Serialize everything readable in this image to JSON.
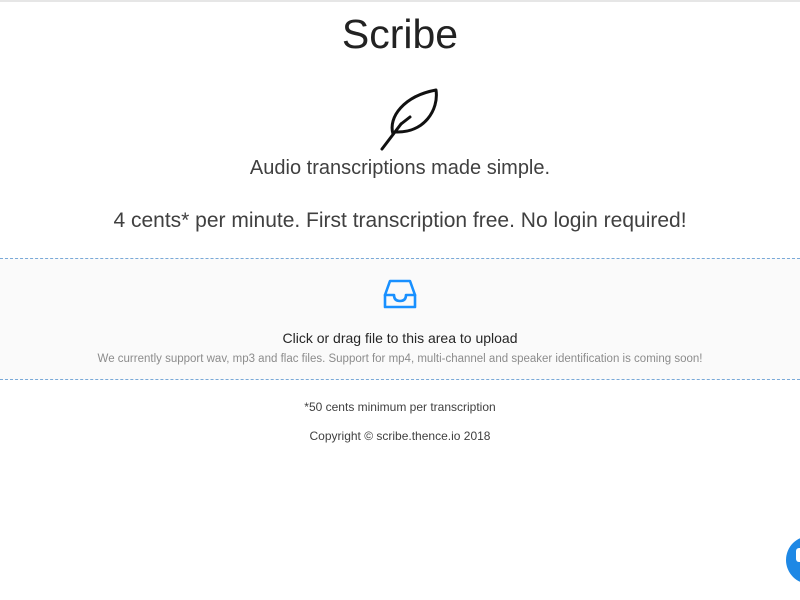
{
  "app": {
    "title": "Scribe",
    "tagline": "Audio transcriptions made simple.",
    "pricing": "4 cents* per minute. First transcription free. No login required!"
  },
  "upload": {
    "icon": "inbox-icon",
    "prompt": "Click or drag file to this area to upload",
    "hint": "We currently support wav, mp3 and flac files. Support for mp4, multi-channel and speaker identification is coming soon!"
  },
  "footer": {
    "footnote": "*50 cents minimum per transcription",
    "copyright": "Copyright © scribe.thence.io 2018"
  },
  "icons": {
    "logo": "feather-icon",
    "chat": "chat-icon"
  },
  "colors": {
    "accent": "#1890ff",
    "dropzone_border": "#79a9d8",
    "dropzone_background": "#fafafa",
    "chat_button": "#1e88e5"
  }
}
